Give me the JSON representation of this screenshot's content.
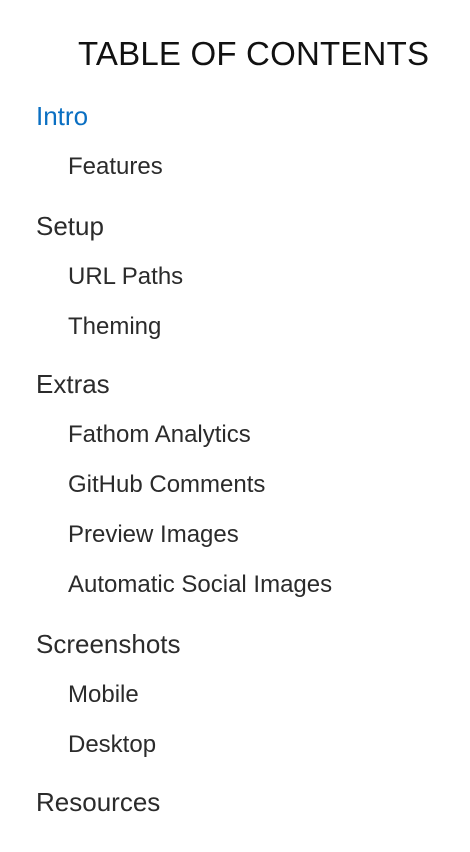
{
  "toc": {
    "title": "TABLE OF CONTENTS",
    "active_color": "#0a6fc2",
    "text_color": "#2b2b2b",
    "items": [
      {
        "label": "Intro",
        "level": 1,
        "active": true
      },
      {
        "label": "Features",
        "level": 2
      },
      {
        "label": "Setup",
        "level": 1
      },
      {
        "label": "URL Paths",
        "level": 2
      },
      {
        "label": "Theming",
        "level": 2
      },
      {
        "label": "Extras",
        "level": 1
      },
      {
        "label": "Fathom Analytics",
        "level": 2
      },
      {
        "label": "GitHub Comments",
        "level": 2
      },
      {
        "label": "Preview Images",
        "level": 2
      },
      {
        "label": "Automatic Social Images",
        "level": 2
      },
      {
        "label": "Screenshots",
        "level": 1
      },
      {
        "label": "Mobile",
        "level": 2
      },
      {
        "label": "Desktop",
        "level": 2
      },
      {
        "label": "Resources",
        "level": 1
      }
    ]
  }
}
